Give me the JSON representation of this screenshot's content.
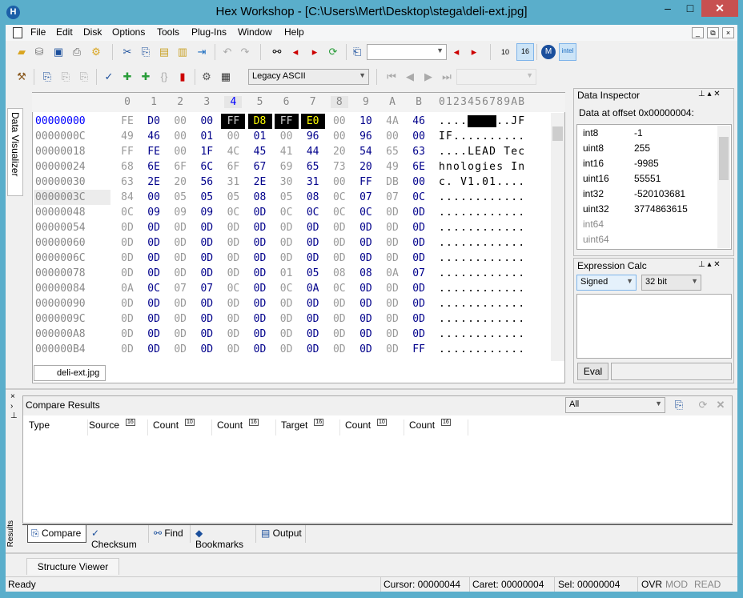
{
  "window": {
    "title": "Hex Workshop - [C:\\Users\\Mert\\Desktop\\stega\\deli-ext.jpg]",
    "minimize": "–",
    "maximize": "□",
    "close": "✕"
  },
  "menu": [
    "File",
    "Edit",
    "Disk",
    "Options",
    "Tools",
    "Plug-Ins",
    "Window",
    "Help"
  ],
  "mdi_controls": [
    "_",
    "⧉",
    "×"
  ],
  "toolbar": {
    "encoding": "Legacy ASCII",
    "search_value": "",
    "nav_value": ""
  },
  "editor": {
    "columns": [
      "0",
      "1",
      "2",
      "3",
      "4",
      "5",
      "6",
      "7",
      "8",
      "9",
      "A",
      "B"
    ],
    "ascii_header": "0123456789AB",
    "selected_column": 4,
    "rows": [
      {
        "offset": "00000000",
        "bytes": [
          "FE",
          "D0",
          "00",
          "00",
          "FF",
          "D8",
          "FF",
          "E0",
          "00",
          "10",
          "4A",
          "46"
        ],
        "ascii": "..........JF"
      },
      {
        "offset": "0000000C",
        "bytes": [
          "49",
          "46",
          "00",
          "01",
          "00",
          "01",
          "00",
          "96",
          "00",
          "96",
          "00",
          "00"
        ],
        "ascii": "IF.........."
      },
      {
        "offset": "00000018",
        "bytes": [
          "FF",
          "FE",
          "00",
          "1F",
          "4C",
          "45",
          "41",
          "44",
          "20",
          "54",
          "65",
          "63"
        ],
        "ascii": "....LEAD Tec"
      },
      {
        "offset": "00000024",
        "bytes": [
          "68",
          "6E",
          "6F",
          "6C",
          "6F",
          "67",
          "69",
          "65",
          "73",
          "20",
          "49",
          "6E"
        ],
        "ascii": "hnologies In"
      },
      {
        "offset": "00000030",
        "bytes": [
          "63",
          "2E",
          "20",
          "56",
          "31",
          "2E",
          "30",
          "31",
          "00",
          "FF",
          "DB",
          "00"
        ],
        "ascii": "c. V1.01...."
      },
      {
        "offset": "0000003C",
        "bytes": [
          "84",
          "00",
          "05",
          "05",
          "05",
          "08",
          "05",
          "08",
          "0C",
          "07",
          "07",
          "0C"
        ],
        "ascii": "............"
      },
      {
        "offset": "00000048",
        "bytes": [
          "0C",
          "09",
          "09",
          "09",
          "0C",
          "0D",
          "0C",
          "0C",
          "0C",
          "0C",
          "0D",
          "0D"
        ],
        "ascii": "............"
      },
      {
        "offset": "00000054",
        "bytes": [
          "0D",
          "0D",
          "0D",
          "0D",
          "0D",
          "0D",
          "0D",
          "0D",
          "0D",
          "0D",
          "0D",
          "0D"
        ],
        "ascii": "............"
      },
      {
        "offset": "00000060",
        "bytes": [
          "0D",
          "0D",
          "0D",
          "0D",
          "0D",
          "0D",
          "0D",
          "0D",
          "0D",
          "0D",
          "0D",
          "0D"
        ],
        "ascii": "............"
      },
      {
        "offset": "0000006C",
        "bytes": [
          "0D",
          "0D",
          "0D",
          "0D",
          "0D",
          "0D",
          "0D",
          "0D",
          "0D",
          "0D",
          "0D",
          "0D"
        ],
        "ascii": "............"
      },
      {
        "offset": "00000078",
        "bytes": [
          "0D",
          "0D",
          "0D",
          "0D",
          "0D",
          "0D",
          "01",
          "05",
          "08",
          "08",
          "0A",
          "07"
        ],
        "ascii": "............"
      },
      {
        "offset": "00000084",
        "bytes": [
          "0A",
          "0C",
          "07",
          "07",
          "0C",
          "0D",
          "0C",
          "0A",
          "0C",
          "0D",
          "0D",
          "0D"
        ],
        "ascii": "............"
      },
      {
        "offset": "00000090",
        "bytes": [
          "0D",
          "0D",
          "0D",
          "0D",
          "0D",
          "0D",
          "0D",
          "0D",
          "0D",
          "0D",
          "0D",
          "0D"
        ],
        "ascii": "............"
      },
      {
        "offset": "0000009C",
        "bytes": [
          "0D",
          "0D",
          "0D",
          "0D",
          "0D",
          "0D",
          "0D",
          "0D",
          "0D",
          "0D",
          "0D",
          "0D"
        ],
        "ascii": "............"
      },
      {
        "offset": "000000A8",
        "bytes": [
          "0D",
          "0D",
          "0D",
          "0D",
          "0D",
          "0D",
          "0D",
          "0D",
          "0D",
          "0D",
          "0D",
          "0D"
        ],
        "ascii": "............"
      },
      {
        "offset": "000000B4",
        "bytes": [
          "0D",
          "0D",
          "0D",
          "0D",
          "0D",
          "0D",
          "0D",
          "0D",
          "0D",
          "0D",
          "0D",
          "FF"
        ],
        "ascii": "............"
      }
    ],
    "file_tab": "deli-ext.jpg"
  },
  "side_tab": "Data Visualizer",
  "data_inspector": {
    "title": "Data Inspector",
    "offset_label": "Data at offset 0x00000004:",
    "rows": [
      {
        "type": "int8",
        "value": "-1"
      },
      {
        "type": "uint8",
        "value": "255"
      },
      {
        "type": "int16",
        "value": "-9985"
      },
      {
        "type": "uint16",
        "value": "55551"
      },
      {
        "type": "int32",
        "value": "-520103681"
      },
      {
        "type": "uint32",
        "value": "3774863615"
      },
      {
        "type": "int64",
        "value": ""
      },
      {
        "type": "uint64",
        "value": ""
      }
    ]
  },
  "expression_calc": {
    "title": "Expression Calc",
    "sign": "Signed",
    "bits": "32 bit",
    "eval": "Eval",
    "result": ""
  },
  "results": {
    "side_label": "Results",
    "title": "Compare Results",
    "filter": "All",
    "columns": [
      {
        "label": "Type",
        "badge": ""
      },
      {
        "label": "Source",
        "badge": "16"
      },
      {
        "label": "Count",
        "badge": "10"
      },
      {
        "label": "Count",
        "badge": "16"
      },
      {
        "label": "Target",
        "badge": "16"
      },
      {
        "label": "Count",
        "badge": "10"
      },
      {
        "label": "Count",
        "badge": "16"
      }
    ],
    "tabs": [
      "Compare",
      "Checksum",
      "Find",
      "Bookmarks",
      "Output"
    ]
  },
  "structure_viewer": "Structure Viewer",
  "status": {
    "ready": "Ready",
    "cursor": "Cursor: 00000044",
    "caret": "Caret: 00000004",
    "sel": "Sel: 00000004",
    "ovr": "OVR",
    "mod": "MOD",
    "read": "READ"
  }
}
